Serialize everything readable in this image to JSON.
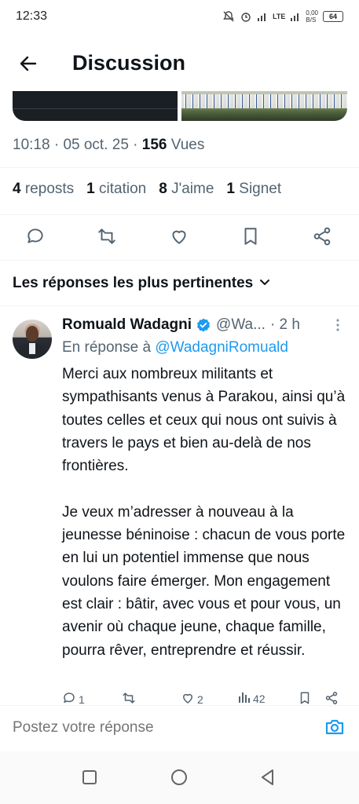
{
  "status_bar": {
    "time": "12:33",
    "network": "LTE",
    "data_rate": "0,00",
    "data_unit": "B/S",
    "battery": "64"
  },
  "header": {
    "title": "Discussion"
  },
  "post": {
    "time": "10:18",
    "date": "05 oct. 25",
    "views_count": "156",
    "views_label": "Vues",
    "reposts_count": "4",
    "reposts_label": "reposts",
    "quotes_count": "1",
    "quotes_label": "citation",
    "likes_count": "8",
    "likes_label": "J'aime",
    "bookmarks_count": "1",
    "bookmarks_label": "Signet"
  },
  "sort": {
    "label": "Les réponses les plus pertinentes"
  },
  "reply": {
    "author": "Romuald Wadagni",
    "handle": "@Wa...",
    "time_ago": "· 2 h",
    "reply_to_prefix": "En réponse à",
    "reply_to_handle": "@WadagniRomuald",
    "text": "Merci aux nombreux militants et sympathisants venus à Parakou, ainsi qu’à toutes celles et ceux qui nous ont suivis à travers le pays et bien au-delà de nos frontières.\n\nJe veux m’adresser à nouveau à la jeunesse béninoise : chacun de vous porte en lui un potentiel immense que nous voulons faire émerger. Mon engagement est clair : bâtir, avec vous et pour vous, un avenir où chaque jeune, chaque famille, pourra rêver, entreprendre et réussir.",
    "replies_count": "1",
    "likes_count": "2",
    "views_count": "42"
  },
  "compose": {
    "placeholder": "Postez votre réponse"
  },
  "colors": {
    "accent": "#1d9bf0",
    "muted": "#536471",
    "text": "#0f1419",
    "verified": "#1d9bf0"
  },
  "icons": {
    "back": "arrow-left-icon",
    "reply": "comment-icon",
    "repost": "repost-icon",
    "like": "heart-icon",
    "bookmark": "bookmark-icon",
    "share": "share-icon",
    "camera": "camera-icon"
  }
}
